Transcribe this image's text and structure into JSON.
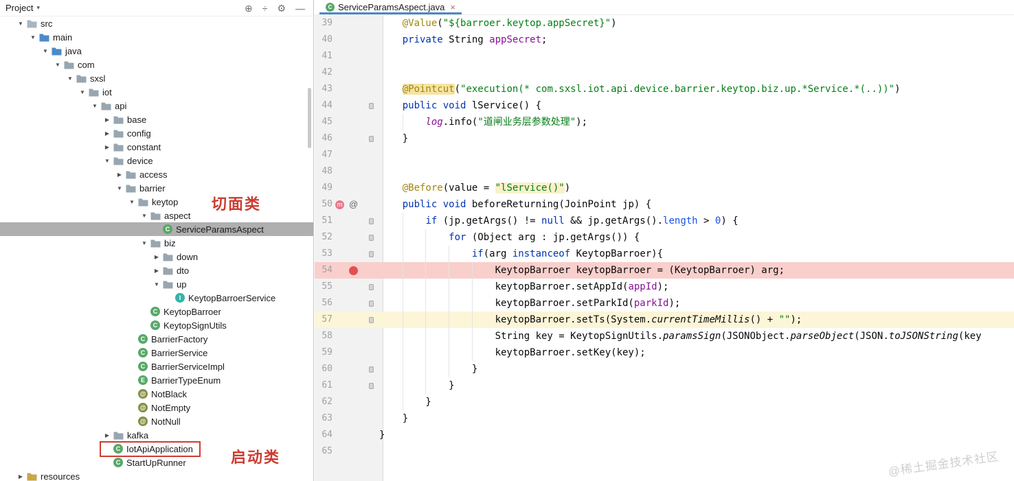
{
  "colors": {
    "theme": {
      "kw": "#0033B3",
      "str": "#067D17",
      "ann": "#9E880D",
      "fld": "#871094",
      "numc": "#1750EB",
      "plain": "#080808",
      "bp-line": "#F9CFCC",
      "cur-line": "#FCF5D7",
      "ann-hl": "#F6E3A4",
      "str-hl": "#FAF1CB",
      "selection": "#AFAFAF",
      "red": "#CE3B30",
      "tab-underline": "#4A88C7",
      "gutter-bg": "#F2F2F2",
      "gutter-border": "#DBDBDB",
      "lnum": "#A1A1A1",
      "bp-dot": "#E24F4F",
      "aop": "#E8788A",
      "watermark": "#CFCFCF",
      "icon-class": "#59A869",
      "icon-interface": "#36B3A8",
      "icon-enum": "#59A869",
      "icon-annotation": "#848F44",
      "folder": "#A8B6BF",
      "folder-blue": "#4E8AC9",
      "package": "#97A6B0",
      "folder-res": "#C9A648"
    }
  },
  "project_panel": {
    "title": "Project",
    "header_icons": [
      {
        "name": "locate",
        "glyph": "⊕"
      },
      {
        "name": "collapse-all",
        "glyph": "÷"
      },
      {
        "name": "settings-gear",
        "glyph": "⚙"
      },
      {
        "name": "hide-panel",
        "glyph": "—"
      }
    ],
    "tree": [
      {
        "label": "src",
        "level": 1,
        "chevron": "exp",
        "icon": "folder"
      },
      {
        "label": "main",
        "level": 2,
        "chevron": "exp",
        "icon": "folder-blue"
      },
      {
        "label": "java",
        "level": 3,
        "chevron": "exp",
        "icon": "folder-blue"
      },
      {
        "label": "com",
        "level": 4,
        "chevron": "exp",
        "icon": "package"
      },
      {
        "label": "sxsl",
        "level": 5,
        "chevron": "exp",
        "icon": "package"
      },
      {
        "label": "iot",
        "level": 6,
        "chevron": "exp",
        "icon": "package"
      },
      {
        "label": "api",
        "level": 7,
        "chevron": "exp",
        "icon": "package"
      },
      {
        "label": "base",
        "level": 8,
        "chevron": "col",
        "icon": "package"
      },
      {
        "label": "config",
        "level": 8,
        "chevron": "col",
        "icon": "package"
      },
      {
        "label": "constant",
        "level": 8,
        "chevron": "col",
        "icon": "package"
      },
      {
        "label": "device",
        "level": 8,
        "chevron": "exp",
        "icon": "package"
      },
      {
        "label": "access",
        "level": 9,
        "chevron": "col",
        "icon": "package"
      },
      {
        "label": "barrier",
        "level": 9,
        "chevron": "exp",
        "icon": "package"
      },
      {
        "label": "keytop",
        "level": 10,
        "chevron": "exp",
        "icon": "package"
      },
      {
        "label": "aspect",
        "level": 11,
        "chevron": "exp",
        "icon": "package"
      },
      {
        "label": "ServiceParamsAspect",
        "level": 12,
        "chevron": "none",
        "icon": "class",
        "selected": true
      },
      {
        "label": "biz",
        "level": 11,
        "chevron": "exp",
        "icon": "package"
      },
      {
        "label": "down",
        "level": 12,
        "chevron": "col",
        "icon": "package"
      },
      {
        "label": "dto",
        "level": 12,
        "chevron": "col",
        "icon": "package"
      },
      {
        "label": "up",
        "level": 12,
        "chevron": "exp",
        "icon": "package"
      },
      {
        "label": "KeytopBarroerService",
        "level": 13,
        "chevron": "none",
        "icon": "interface"
      },
      {
        "label": "KeytopBarroer",
        "level": 11,
        "chevron": "none",
        "icon": "class"
      },
      {
        "label": "KeytopSignUtils",
        "level": 11,
        "chevron": "none",
        "icon": "class"
      },
      {
        "label": "BarrierFactory",
        "level": 10,
        "chevron": "none",
        "icon": "class"
      },
      {
        "label": "BarrierService",
        "level": 10,
        "chevron": "none",
        "icon": "class"
      },
      {
        "label": "BarrierServiceImpl",
        "level": 10,
        "chevron": "none",
        "icon": "class"
      },
      {
        "label": "BarrierTypeEnum",
        "level": 10,
        "chevron": "none",
        "icon": "enum"
      },
      {
        "label": "NotBlack",
        "level": 10,
        "chevron": "none",
        "icon": "annotation"
      },
      {
        "label": "NotEmpty",
        "level": 10,
        "chevron": "none",
        "icon": "annotation"
      },
      {
        "label": "NotNull",
        "level": 10,
        "chevron": "none",
        "icon": "annotation"
      },
      {
        "label": "kafka",
        "level": 8,
        "chevron": "col",
        "icon": "package"
      },
      {
        "label": "IotApiApplication",
        "level": 8,
        "chevron": "none",
        "icon": "class",
        "boxed": true
      },
      {
        "label": "StartUpRunner",
        "level": 8,
        "chevron": "none",
        "icon": "class"
      },
      {
        "label": "resources",
        "level": 1,
        "chevron": "col",
        "icon": "folder-res"
      }
    ]
  },
  "annotations": {
    "aspect_label": "切面类",
    "startup_label": "启动类"
  },
  "editor": {
    "tab": {
      "title": "ServiceParamsAspect.java",
      "close": "×"
    },
    "watermark": "@稀土掘金技术社区",
    "gutter": {
      "breakpoint_line": 54,
      "aop_line": 50,
      "fold_lines": [
        44,
        46,
        51,
        52,
        53,
        55,
        56,
        57,
        60,
        61
      ]
    },
    "highlights": [
      {
        "line": 54,
        "kind": "breakpoint"
      },
      {
        "line": 57,
        "kind": "current"
      }
    ],
    "indent_guides": [
      {
        "col": 4,
        "from": 45,
        "to": 45
      },
      {
        "col": 4,
        "from": 51,
        "to": 62
      },
      {
        "col": 8,
        "from": 52,
        "to": 61
      },
      {
        "col": 12,
        "from": 53,
        "to": 60
      },
      {
        "col": 16,
        "from": 54,
        "to": 59
      }
    ],
    "lines": [
      {
        "num": 39,
        "tokens": [
          [
            "p",
            "    "
          ],
          [
            "ann",
            "@Value"
          ],
          [
            "p",
            "("
          ],
          [
            "str",
            "\"${barroer.keytop.appSecret}\""
          ],
          [
            "p",
            ")"
          ]
        ]
      },
      {
        "num": 40,
        "tokens": [
          [
            "p",
            "    "
          ],
          [
            "kw",
            "private"
          ],
          [
            "p",
            " String "
          ],
          [
            "fld",
            "appSecret"
          ],
          [
            "p",
            ";"
          ]
        ]
      },
      {
        "num": 41,
        "tokens": []
      },
      {
        "num": 42,
        "tokens": []
      },
      {
        "num": 43,
        "tokens": [
          [
            "p",
            "    "
          ],
          [
            "annhl",
            "@Pointcut"
          ],
          [
            "p",
            "("
          ],
          [
            "str",
            "\"execution(* com.sxsl.iot.api.device.barrier.keytop.biz.up.*Service.*(..))\""
          ],
          [
            "p",
            ")"
          ]
        ]
      },
      {
        "num": 44,
        "tokens": [
          [
            "p",
            "    "
          ],
          [
            "kw",
            "public"
          ],
          [
            "p",
            " "
          ],
          [
            "kw",
            "void"
          ],
          [
            "p",
            " lService() {"
          ]
        ]
      },
      {
        "num": 45,
        "tokens": [
          [
            "p",
            "        "
          ],
          [
            "fldi",
            "log"
          ],
          [
            "p",
            ".info("
          ],
          [
            "str",
            "\"道闸业务层参数处理\""
          ],
          [
            "p",
            ");"
          ]
        ]
      },
      {
        "num": 46,
        "tokens": [
          [
            "p",
            "    }"
          ]
        ]
      },
      {
        "num": 47,
        "tokens": []
      },
      {
        "num": 48,
        "tokens": []
      },
      {
        "num": 49,
        "tokens": [
          [
            "p",
            "    "
          ],
          [
            "ann",
            "@Before"
          ],
          [
            "p",
            "(value = "
          ],
          [
            "strhl",
            "\"lService()\""
          ],
          [
            "p",
            ")"
          ]
        ]
      },
      {
        "num": 50,
        "tokens": [
          [
            "p",
            "    "
          ],
          [
            "kw",
            "public"
          ],
          [
            "p",
            " "
          ],
          [
            "kw",
            "void"
          ],
          [
            "p",
            " beforeReturning(JoinPoint jp) {"
          ]
        ]
      },
      {
        "num": 51,
        "tokens": [
          [
            "p",
            "        "
          ],
          [
            "kw",
            "if"
          ],
          [
            "p",
            " (jp.getArgs() != "
          ],
          [
            "kw",
            "null"
          ],
          [
            "p",
            " && jp.getArgs()."
          ],
          [
            "num",
            "length"
          ],
          [
            "p",
            " > "
          ],
          [
            "num",
            "0"
          ],
          [
            "p",
            ") {"
          ]
        ]
      },
      {
        "num": 52,
        "tokens": [
          [
            "p",
            "            "
          ],
          [
            "kw",
            "for"
          ],
          [
            "p",
            " (Object arg : jp.getArgs()) {"
          ]
        ]
      },
      {
        "num": 53,
        "tokens": [
          [
            "p",
            "                "
          ],
          [
            "kw",
            "if"
          ],
          [
            "p",
            "(arg "
          ],
          [
            "kw",
            "instanceof"
          ],
          [
            "p",
            " KeytopBarroer){"
          ]
        ]
      },
      {
        "num": 54,
        "tokens": [
          [
            "p",
            "                    KeytopBarroer keytopBarroer = (KeytopBarroer) arg;"
          ]
        ]
      },
      {
        "num": 55,
        "tokens": [
          [
            "p",
            "                    keytopBarroer.setAppId("
          ],
          [
            "fld",
            "appId"
          ],
          [
            "p",
            ");"
          ]
        ]
      },
      {
        "num": 56,
        "tokens": [
          [
            "p",
            "                    keytopBarroer.setParkId("
          ],
          [
            "fld",
            "parkId"
          ],
          [
            "p",
            ");"
          ]
        ]
      },
      {
        "num": 57,
        "tokens": [
          [
            "p",
            "                    keytopBarroer.setTs(System."
          ],
          [
            "ital",
            "currentTimeMillis"
          ],
          [
            "p",
            "() + "
          ],
          [
            "str",
            "\"\""
          ],
          [
            "p",
            ");"
          ]
        ]
      },
      {
        "num": 58,
        "tokens": [
          [
            "p",
            "                    String key = KeytopSignUtils."
          ],
          [
            "ital",
            "paramsSign"
          ],
          [
            "p",
            "(JSONObject."
          ],
          [
            "ital",
            "parseObject"
          ],
          [
            "p",
            "(JSON."
          ],
          [
            "ital",
            "toJSONString"
          ],
          [
            "p",
            "(key"
          ]
        ]
      },
      {
        "num": 59,
        "tokens": [
          [
            "p",
            "                    keytopBarroer.setKey(key);"
          ]
        ]
      },
      {
        "num": 60,
        "tokens": [
          [
            "p",
            "                }"
          ]
        ]
      },
      {
        "num": 61,
        "tokens": [
          [
            "p",
            "            }"
          ]
        ]
      },
      {
        "num": 62,
        "tokens": [
          [
            "p",
            "        }"
          ]
        ]
      },
      {
        "num": 63,
        "tokens": [
          [
            "p",
            "    }"
          ]
        ]
      },
      {
        "num": 64,
        "tokens": [
          [
            "p",
            "}"
          ]
        ]
      },
      {
        "num": 65,
        "tokens": []
      }
    ]
  }
}
